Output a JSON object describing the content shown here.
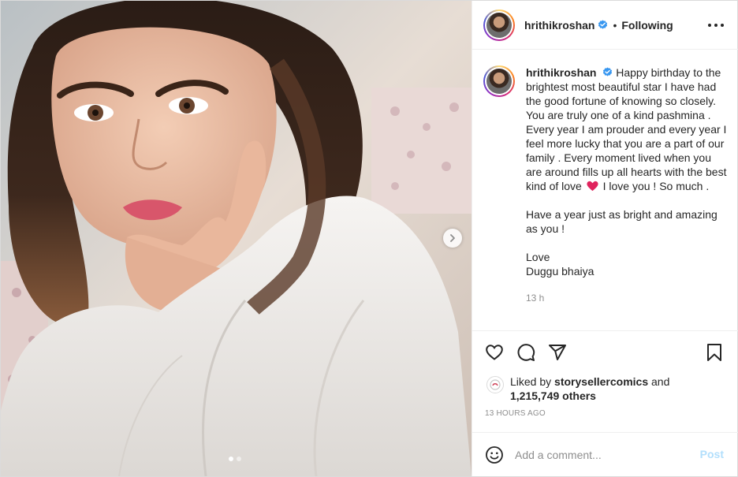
{
  "post": {
    "author": "hrithikroshan",
    "follow_status": "Following",
    "separator": "•",
    "verified_icon": "verified-badge-icon",
    "more_icon": "more-options-icon",
    "caption": {
      "username": "hrithikroshan",
      "para1_start": "Happy birthday to the brightest most beautiful star I have had the good fortune of knowing so closely. You are truly one of a kind pashmina . Every year I am prouder and every year I feel more lucky that you are a part of our family . Every moment lived when you are around fills up all hearts with the best kind of love",
      "para1_end": "I love you ! So much .",
      "para2": "Have a year just as bright and amazing as you !",
      "para3_line1": "Love",
      "para3_line2": "Duggu bhaiya",
      "time_relative": "13 h"
    },
    "likes": {
      "prefix": "Liked by",
      "user": "storysellercomics",
      "conjunction": "and",
      "count": "1,215,749 others"
    },
    "posted_ago": "13 HOURS AGO",
    "comment_placeholder": "Add a comment...",
    "post_button": "Post",
    "carousel": {
      "total_slides": 2,
      "current_slide": 1
    },
    "colors": {
      "verified": "#3897f0",
      "heart_emoji": "#e0245e",
      "post_button_disabled": "#b2dffc",
      "muted_text": "#8e8e8e"
    }
  }
}
